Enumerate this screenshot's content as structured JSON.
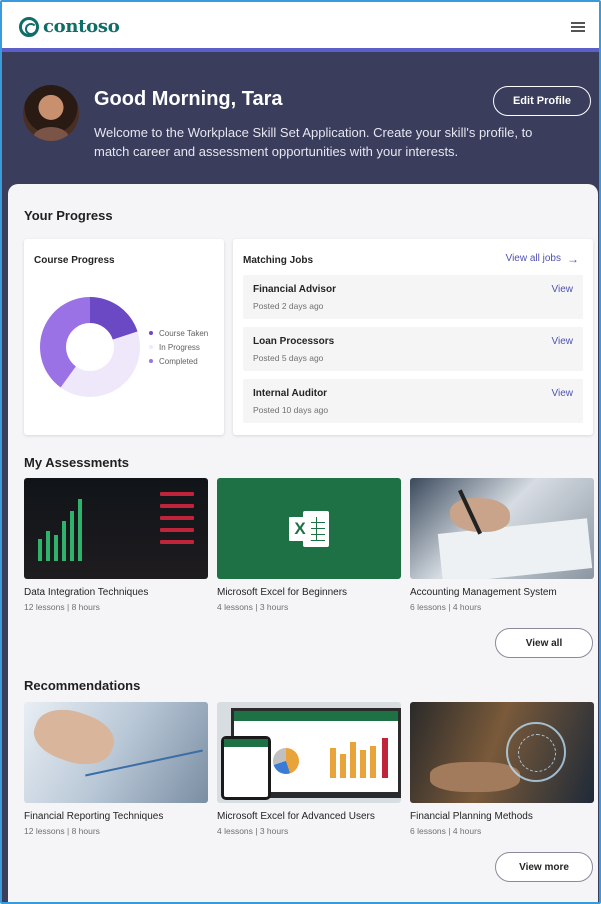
{
  "header": {
    "brand": "contoso",
    "logo_icon": "contoso-logo-icon",
    "menu_icon": "hamburger-menu-icon"
  },
  "hero": {
    "greeting": "Good Morning, Tara",
    "welcome": "Welcome to the Workplace Skill Set Application. Create your skill's profile, to match career and assessment opportunities with your interests.",
    "edit_label": "Edit Profile"
  },
  "progress": {
    "title": "Your Progress",
    "course": {
      "title": "Course Progress",
      "legend": [
        {
          "label": "Course Taken",
          "color": "#6b48c4"
        },
        {
          "label": "In Progress",
          "color": "#efe8fb"
        },
        {
          "label": "Completed",
          "color": "#9a72e6"
        }
      ]
    },
    "jobs": {
      "title": "Matching Jobs",
      "view_all": "View all jobs",
      "items": [
        {
          "title": "Financial Advisor",
          "posted": "Posted 2 days ago",
          "action": "View"
        },
        {
          "title": "Loan Processors",
          "posted": "Posted 5 days ago",
          "action": "View"
        },
        {
          "title": "Internal Auditor",
          "posted": "Posted 10 days ago",
          "action": "View"
        }
      ]
    }
  },
  "chart_data": {
    "type": "pie",
    "categories": [
      "Course Taken",
      "In Progress",
      "Completed"
    ],
    "values": [
      20,
      40,
      40
    ],
    "colors": [
      "#6b48c4",
      "#efe8fb",
      "#9a72e6"
    ],
    "title": "Course Progress",
    "legend": "right"
  },
  "assessments": {
    "title": "My Assessments",
    "items": [
      {
        "title": "Data Integration Techniques",
        "meta": "12 lessons | 8 hours"
      },
      {
        "title": "Microsoft Excel for Beginners",
        "meta": "4 lessons | 3 hours"
      },
      {
        "title": "Accounting Management System",
        "meta": "6 lessons | 4 hours"
      }
    ],
    "button": "View all"
  },
  "recommendations": {
    "title": "Recommendations",
    "items": [
      {
        "title": "Financial Reporting Techniques",
        "meta": "12 lessons | 8 hours"
      },
      {
        "title": "Microsoft Excel for Advanced Users",
        "meta": "4 lessons | 3 hours"
      },
      {
        "title": "Financial Planning Methods",
        "meta": "6 lessons | 4 hours"
      }
    ],
    "button": "View more"
  },
  "colors": {
    "accent": "#4f52b2",
    "hero_bg": "#3a3d5c",
    "brand": "#0f6e67"
  }
}
